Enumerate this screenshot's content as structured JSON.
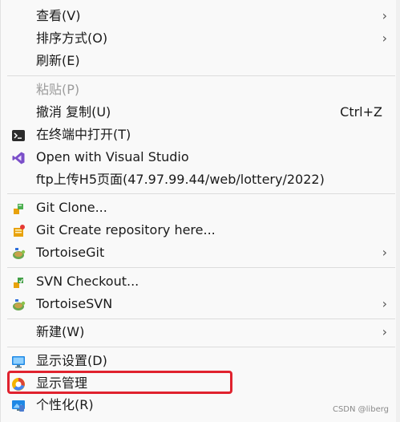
{
  "menu": {
    "items": [
      {
        "label": "查看(V)",
        "chevron": "›"
      },
      {
        "label": "排序方式(O)",
        "chevron": "›"
      },
      {
        "label": "刷新(E)"
      },
      {
        "label": "粘贴(P)"
      },
      {
        "label": "撤消 复制(U)",
        "shortcut": "Ctrl+Z"
      },
      {
        "label": "在终端中打开(T)",
        "icon": "terminal-icon"
      },
      {
        "label": "Open with Visual Studio",
        "icon": "visual-studio-icon"
      },
      {
        "label": "ftp上传H5页面(47.97.99.44/web/lottery/2022)"
      },
      {
        "label": "Git Clone...",
        "icon": "git-clone-icon"
      },
      {
        "label": "Git Create repository here...",
        "icon": "git-create-repo-icon"
      },
      {
        "label": "TortoiseGit",
        "icon": "tortoisegit-icon",
        "chevron": "›"
      },
      {
        "label": "SVN Checkout...",
        "icon": "svn-checkout-icon"
      },
      {
        "label": "TortoiseSVN",
        "icon": "tortoisesvn-icon",
        "chevron": "›"
      },
      {
        "label": "新建(W)",
        "chevron": "›"
      },
      {
        "label": "显示设置(D)",
        "icon": "display-settings-icon"
      },
      {
        "label": "显示管理",
        "icon": "display-manager-icon"
      },
      {
        "label": "个性化(R)",
        "icon": "personalize-icon"
      }
    ]
  },
  "watermark": "CSDN @liberg",
  "colors": {
    "highlight_border": "#e0222e",
    "disabled_text": "#9c9c9c"
  }
}
